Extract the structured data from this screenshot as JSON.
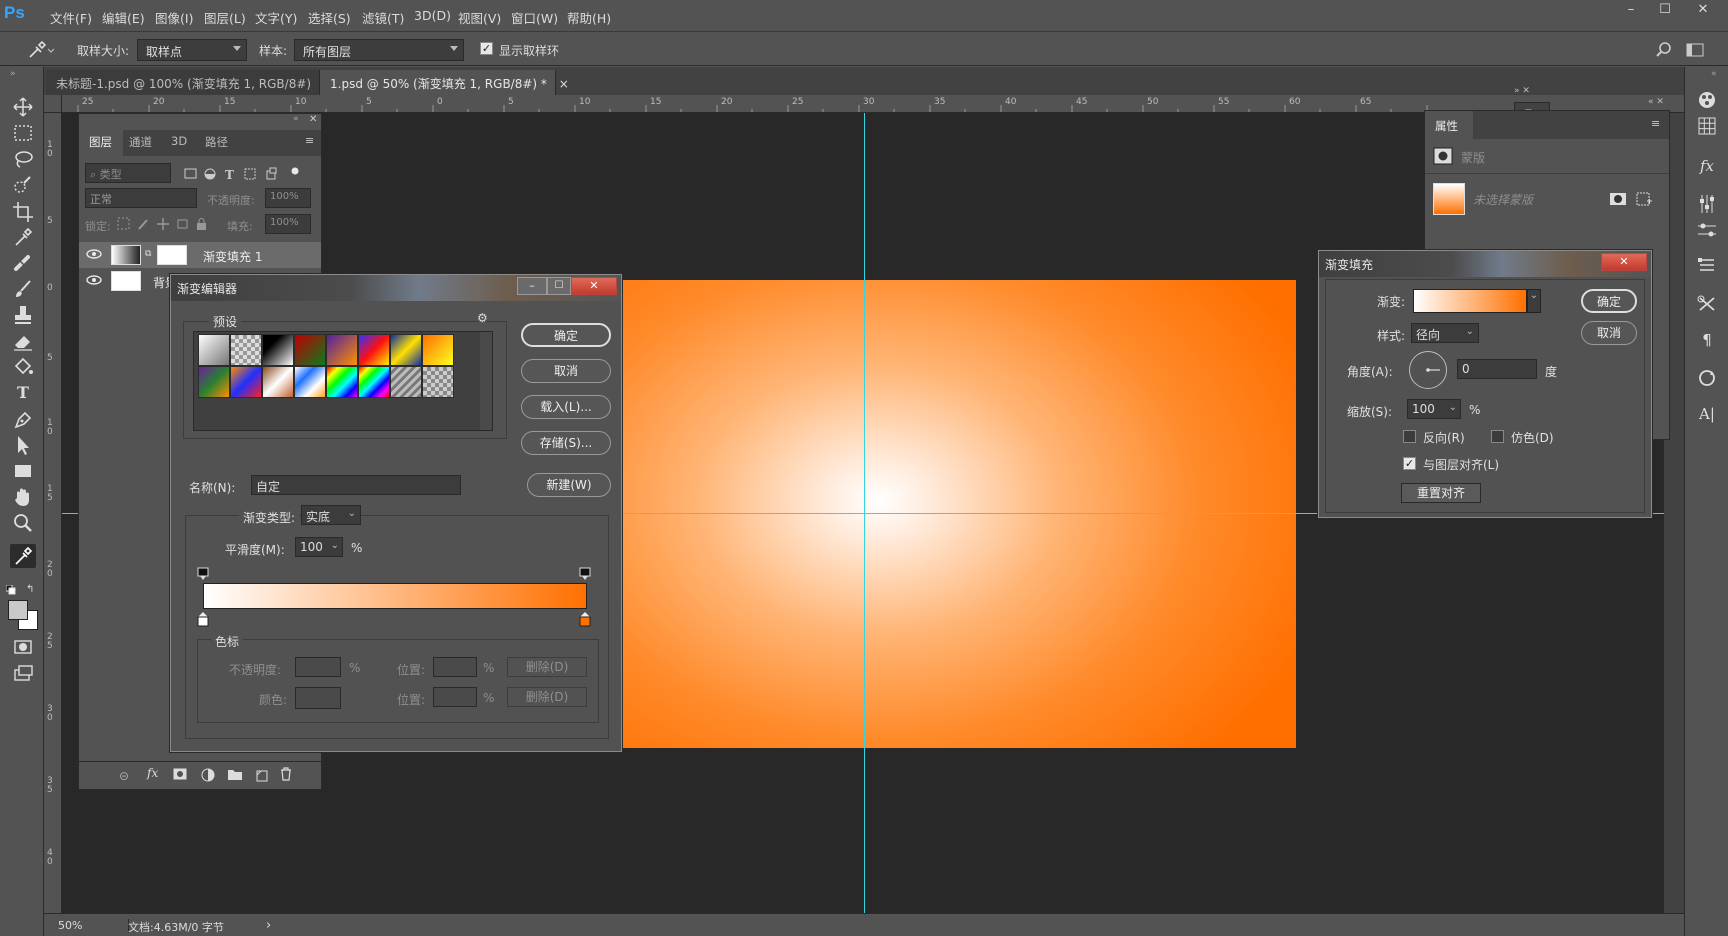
{
  "app": {
    "logo": "Ps"
  },
  "menu": [
    "文件(F)",
    "编辑(E)",
    "图像(I)",
    "图层(L)",
    "文字(Y)",
    "选择(S)",
    "滤镜(T)",
    "3D(D)",
    "视图(V)",
    "窗口(W)",
    "帮助(H)"
  ],
  "window_controls": [
    "–",
    "☐",
    "✕"
  ],
  "options": {
    "sample_size_label": "取样大小:",
    "sample_size_value": "取样点",
    "sample_label": "样本:",
    "sample_value": "所有图层",
    "show_ring_label": "显示取样环",
    "show_ring_checked": true
  },
  "tabs": [
    {
      "label": "未标题-1.psd @ 100% (渐变填充 1, RGB/8#)",
      "close": "×",
      "active": false
    },
    {
      "label": "1.psd @ 50% (渐变填充 1, RGB/8#) *",
      "close": "×",
      "active": true
    }
  ],
  "ruler_h": [
    "25",
    "20",
    "15",
    "10",
    "5",
    "0",
    "5",
    "10",
    "15",
    "20",
    "25",
    "30",
    "35",
    "40",
    "45",
    "50",
    "55",
    "60",
    "65"
  ],
  "ruler_v": [
    "1\n0",
    "5",
    "0",
    "5",
    "1\n0",
    "1\n5",
    "2\n0",
    "2\n5",
    "3\n0",
    "3\n5",
    "4\n0"
  ],
  "status": {
    "zoom": "50%",
    "doc": "文档:4.63M/0 字节",
    "arrow": "›"
  },
  "layers_panel": {
    "tabs": [
      "图层",
      "通道",
      "3D",
      "路径"
    ],
    "filter_placeholder": "类型",
    "blend_mode": "正常",
    "opacity_label": "不透明度:",
    "opacity_value": "100%",
    "lock_label": "锁定:",
    "fill_label": "填充:",
    "fill_value": "100%",
    "layers": [
      {
        "name": "渐变填充 1"
      },
      {
        "name": "背景"
      }
    ],
    "bottom_icons": [
      "link-icon",
      "fx-icon",
      "mask-icon",
      "adjustment-icon",
      "folder-icon",
      "new-layer-icon",
      "trash-icon"
    ],
    "fx_text": "fx"
  },
  "gradient_editor": {
    "title": "渐变编辑器",
    "presets_label": "预设",
    "buttons": {
      "ok": "确定",
      "cancel": "取消",
      "load": "载入(L)...",
      "save": "存储(S)...",
      "new": "新建(W)"
    },
    "name_label": "名称(N):",
    "name_value": "自定",
    "type_label": "渐变类型:",
    "type_value": "实底",
    "smooth_label": "平滑度(M):",
    "smooth_value": "100",
    "smooth_unit": "%",
    "stops_label": "色标",
    "opacity_label": "不透明度:",
    "position_label": "位置:",
    "percent": "%",
    "delete_label": "删除(D)",
    "color_label": "颜色:",
    "gradient_start": "#ffffff",
    "gradient_end": "#ff7000",
    "presets": [
      [
        "#ffffff→#000000",
        "#d0d0d0/transparent",
        "#000000→#ffffff",
        "#c00000→#0050a0",
        "#6020a0→#f08000",
        "#3040ff→#ff1010",
        "#20a0ff→#ffe000",
        "#ff8000→#ffff00"
      ],
      [
        "#205080→#f0a000",
        "#d03020→#2030ff",
        "#a06030→#ffffff",
        "#ffffff→#2060ff",
        "#ff0000→#0000ff rainbow",
        "#ff00ff→#00ffff rainbow",
        "#c0c0c0 stripes",
        "#b0b0b0/transparent"
      ]
    ]
  },
  "properties": {
    "tab": "属性",
    "section": "蒙版",
    "mask_label": "未选择蒙版"
  },
  "gradient_fill": {
    "title": "渐变填充",
    "gradient_label": "渐变:",
    "style_label": "样式:",
    "style_value": "径向",
    "angle_label": "角度(A):",
    "angle_value": "0",
    "angle_unit": "度",
    "scale_label": "缩放(S):",
    "scale_value": "100",
    "scale_unit": "%",
    "reverse_label": "反向(R)",
    "reverse_checked": false,
    "dither_label": "仿色(D)",
    "dither_checked": false,
    "align_label": "与图层对齐(L)",
    "align_checked": true,
    "reset_label": "重置对齐",
    "ok": "确定",
    "cancel": "取消"
  },
  "colors": {
    "accent": "#31a8ff",
    "orange": "#ff7000",
    "guide": "#33d6e0",
    "canvas_bg": "#282828"
  }
}
